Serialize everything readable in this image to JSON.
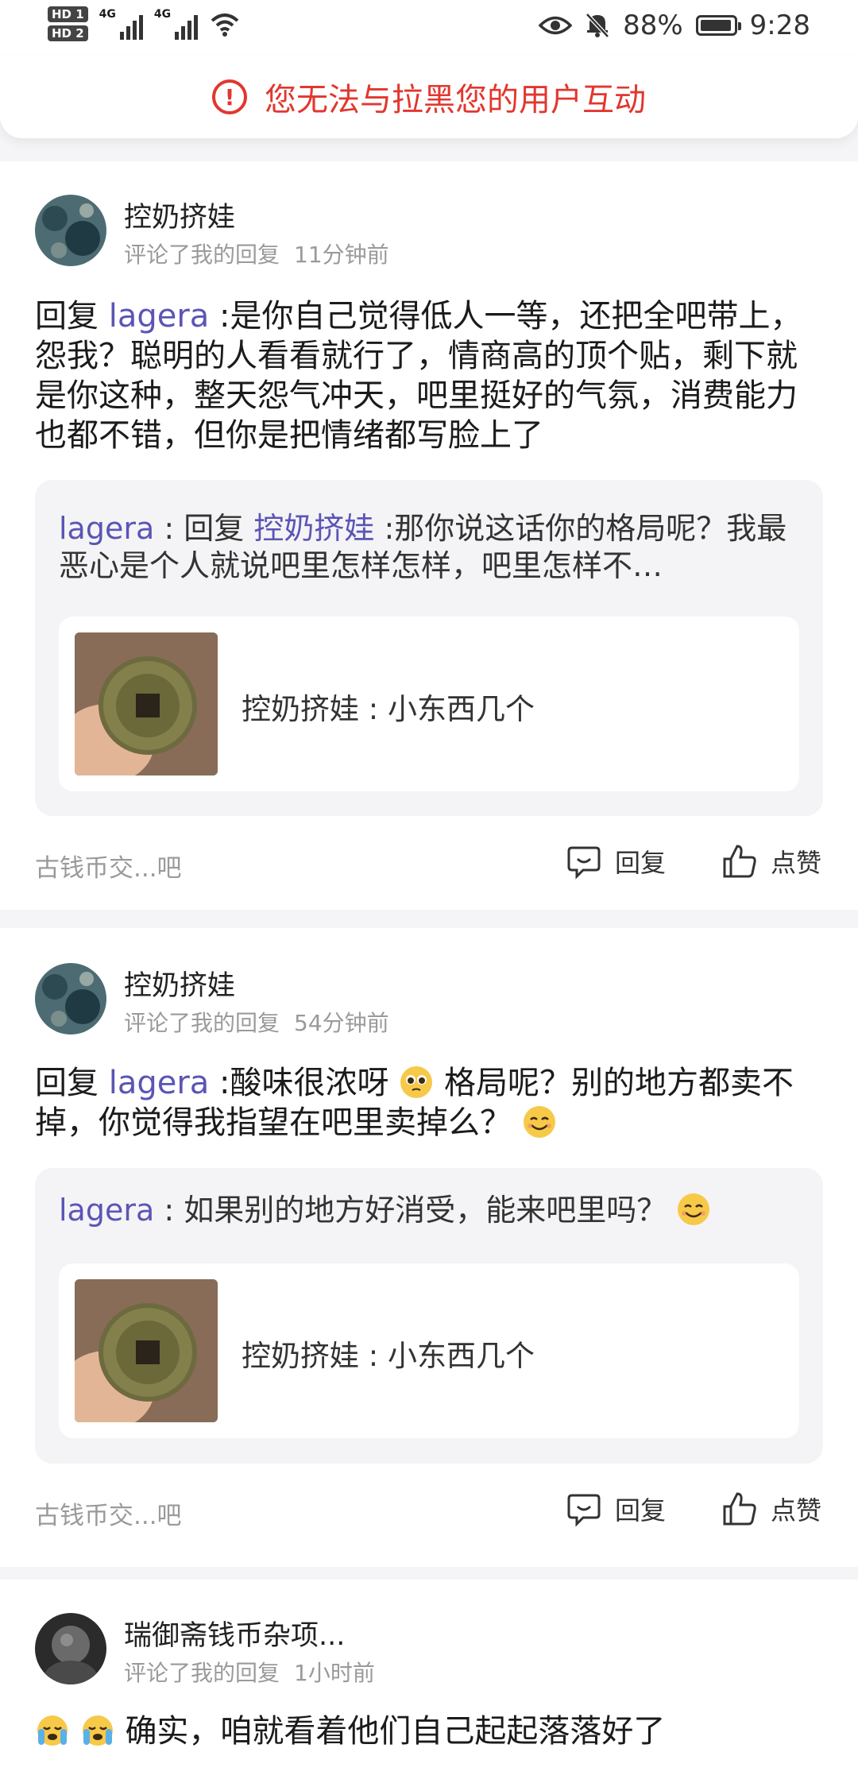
{
  "status_bar": {
    "hd_labels": [
      "HD 1",
      "HD 2"
    ],
    "network_labels": [
      "4G",
      "4G"
    ],
    "icons": [
      "eye-icon",
      "bell-off-icon"
    ],
    "battery_percent": "88%",
    "battery_level": 0.88,
    "time": "9:28"
  },
  "banner": {
    "icon": "warning-circle-icon",
    "text": "您无法与拉黑您的用户互动"
  },
  "notifications": [
    {
      "username": "控奶挤娃",
      "action": "评论了我的回复",
      "time": "11分钟前",
      "reply_prefix": "回复",
      "mention": "lagera",
      "body": ":是你自己觉得低人一等，还把全吧带上，怨我？聪明的人看看就行了，情商高的顶个贴，剩下就是你这种，整天怨气冲天，吧里挺好的气氛，消费能力也都不错，但你是把情绪都写脸上了",
      "quote": {
        "author": "lagera",
        "sep": " : ",
        "reply_prefix": "回复",
        "mention": "控奶挤娃",
        "body": ":那你说这话你的格局呢？我最恶心是个人就说吧里怎样怎样，吧里怎样不…",
        "thread_title": "控奶挤娃 : 小东西几个"
      },
      "forum": "古钱币交...吧",
      "reply_label": "回复",
      "like_label": "点赞"
    },
    {
      "username": "控奶挤娃",
      "action": "评论了我的回复",
      "time": "54分钟前",
      "reply_prefix": "回复",
      "mention": "lagera",
      "body_a": ":酸味很浓呀",
      "body_b": "格局呢？别的地方都卖不掉，你觉得我指望在吧里卖掉么？",
      "emoji_a": "pleading-face-emoji",
      "emoji_b": "smiling-face-emoji",
      "quote": {
        "author": "lagera",
        "sep": " : ",
        "body": "如果别的地方好消受，能来吧里吗？",
        "emoji": "smiling-face-emoji",
        "thread_title": "控奶挤娃 : 小东西几个"
      },
      "forum": "古钱币交...吧",
      "reply_label": "回复",
      "like_label": "点赞"
    },
    {
      "username": "瑞御斋钱币杂项...",
      "action": "评论了我的回复",
      "time": "1小时前",
      "emoji": "crying-face-emoji",
      "body": "确实，咱就看着他们自己起起落落好了"
    }
  ],
  "colors": {
    "warning": "#e1372e",
    "mention": "#5b55b5",
    "meta": "#9a9a9a"
  }
}
